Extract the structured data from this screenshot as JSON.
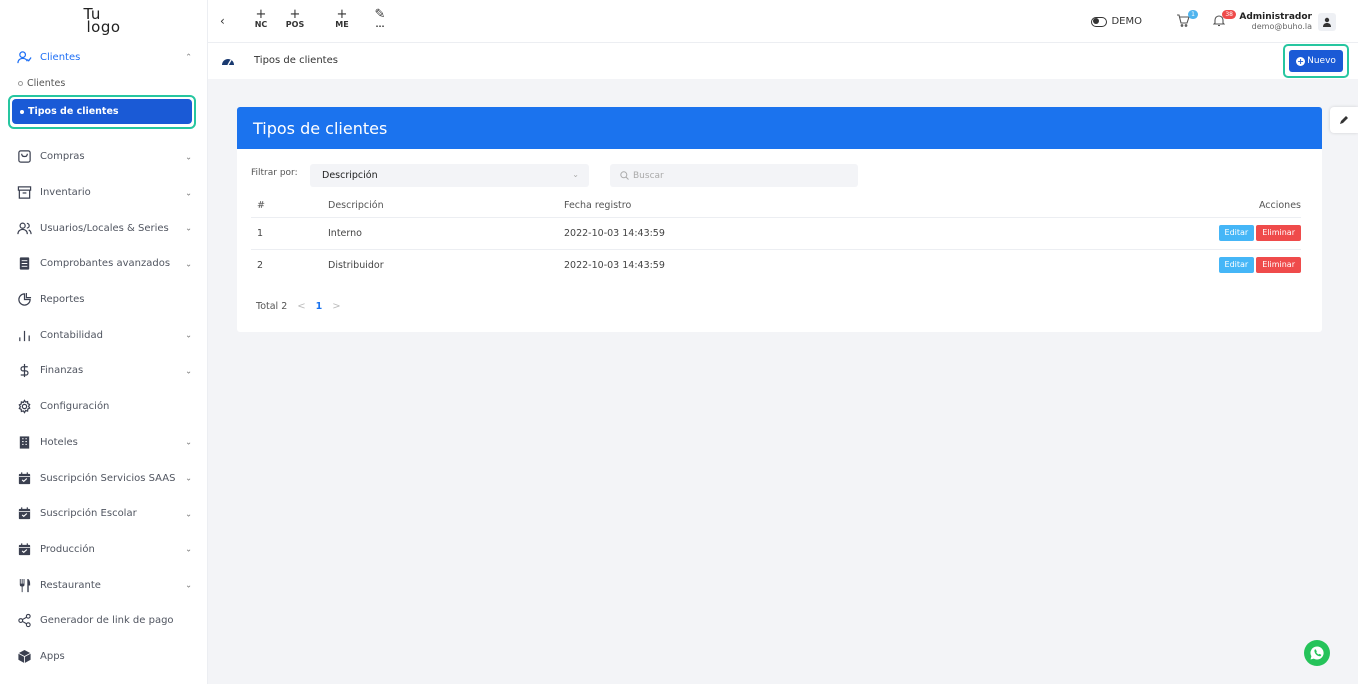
{
  "logo": {
    "line1": "Tu",
    "line2": "logo"
  },
  "sidebar": {
    "clientes": {
      "label": "Clientes",
      "sub1": "Clientes",
      "sub2": "Tipos de clientes"
    },
    "items": [
      {
        "label": "Compras",
        "icon": "bag-icon",
        "has_chevron": true
      },
      {
        "label": "Inventario",
        "icon": "archive-icon",
        "has_chevron": true
      },
      {
        "label": "Usuarios/Locales & Series",
        "icon": "users-icon",
        "has_chevron": true
      },
      {
        "label": "Comprobantes avanzados",
        "icon": "document-icon",
        "has_chevron": true
      },
      {
        "label": "Reportes",
        "icon": "pie-chart-icon",
        "has_chevron": false
      },
      {
        "label": "Contabilidad",
        "icon": "bar-chart-icon",
        "has_chevron": true
      },
      {
        "label": "Finanzas",
        "icon": "dollar-icon",
        "has_chevron": true
      },
      {
        "label": "Configuración",
        "icon": "gear-icon",
        "has_chevron": false
      },
      {
        "label": "Hoteles",
        "icon": "building-icon",
        "has_chevron": true
      },
      {
        "label": "Suscripción Servicios SAAS",
        "icon": "calendar-check-icon",
        "has_chevron": true
      },
      {
        "label": "Suscripción Escolar",
        "icon": "calendar-check-icon",
        "has_chevron": true
      },
      {
        "label": "Producción",
        "icon": "calendar-check-icon",
        "has_chevron": true
      },
      {
        "label": "Restaurante",
        "icon": "utensils-icon",
        "has_chevron": true
      },
      {
        "label": "Generador de link de pago",
        "icon": "share-icon",
        "has_chevron": false
      },
      {
        "label": "Apps",
        "icon": "box-icon",
        "has_chevron": false
      }
    ]
  },
  "topbar": {
    "back": "‹",
    "quick": [
      {
        "label": "NC",
        "plus": "+"
      },
      {
        "label": "POS",
        "plus": "+"
      },
      {
        "label": "ME",
        "plus": "+"
      },
      {
        "label": "...",
        "plus": "✎"
      }
    ],
    "demo_label": "DEMO",
    "cart_count": "1",
    "notif_count": "38",
    "user_name": "Administrador",
    "user_email": "demo@buho.la"
  },
  "breadcrumb": {
    "text": "Tipos de clientes",
    "new_button": "Nuevo"
  },
  "card": {
    "title": "Tipos de clientes",
    "filter_label": "Filtrar por:",
    "filter_value": "Descripción",
    "search_placeholder": "Buscar",
    "columns": {
      "num": "#",
      "desc": "Descripción",
      "date": "Fecha registro",
      "actions": "Acciones"
    },
    "rows": [
      {
        "num": "1",
        "desc": "Interno",
        "date": "2022-10-03 14:43:59",
        "edit": "Editar",
        "delete": "Eliminar"
      },
      {
        "num": "2",
        "desc": "Distribuidor",
        "date": "2022-10-03 14:43:59",
        "edit": "Editar",
        "delete": "Eliminar"
      }
    ],
    "total": "Total 2",
    "page": "1"
  },
  "colors": {
    "primary": "#1b73ee",
    "active_nav": "#1a5ad6",
    "highlight": "#26c6a0",
    "edit": "#45b6f7",
    "delete": "#ef4b4b"
  }
}
